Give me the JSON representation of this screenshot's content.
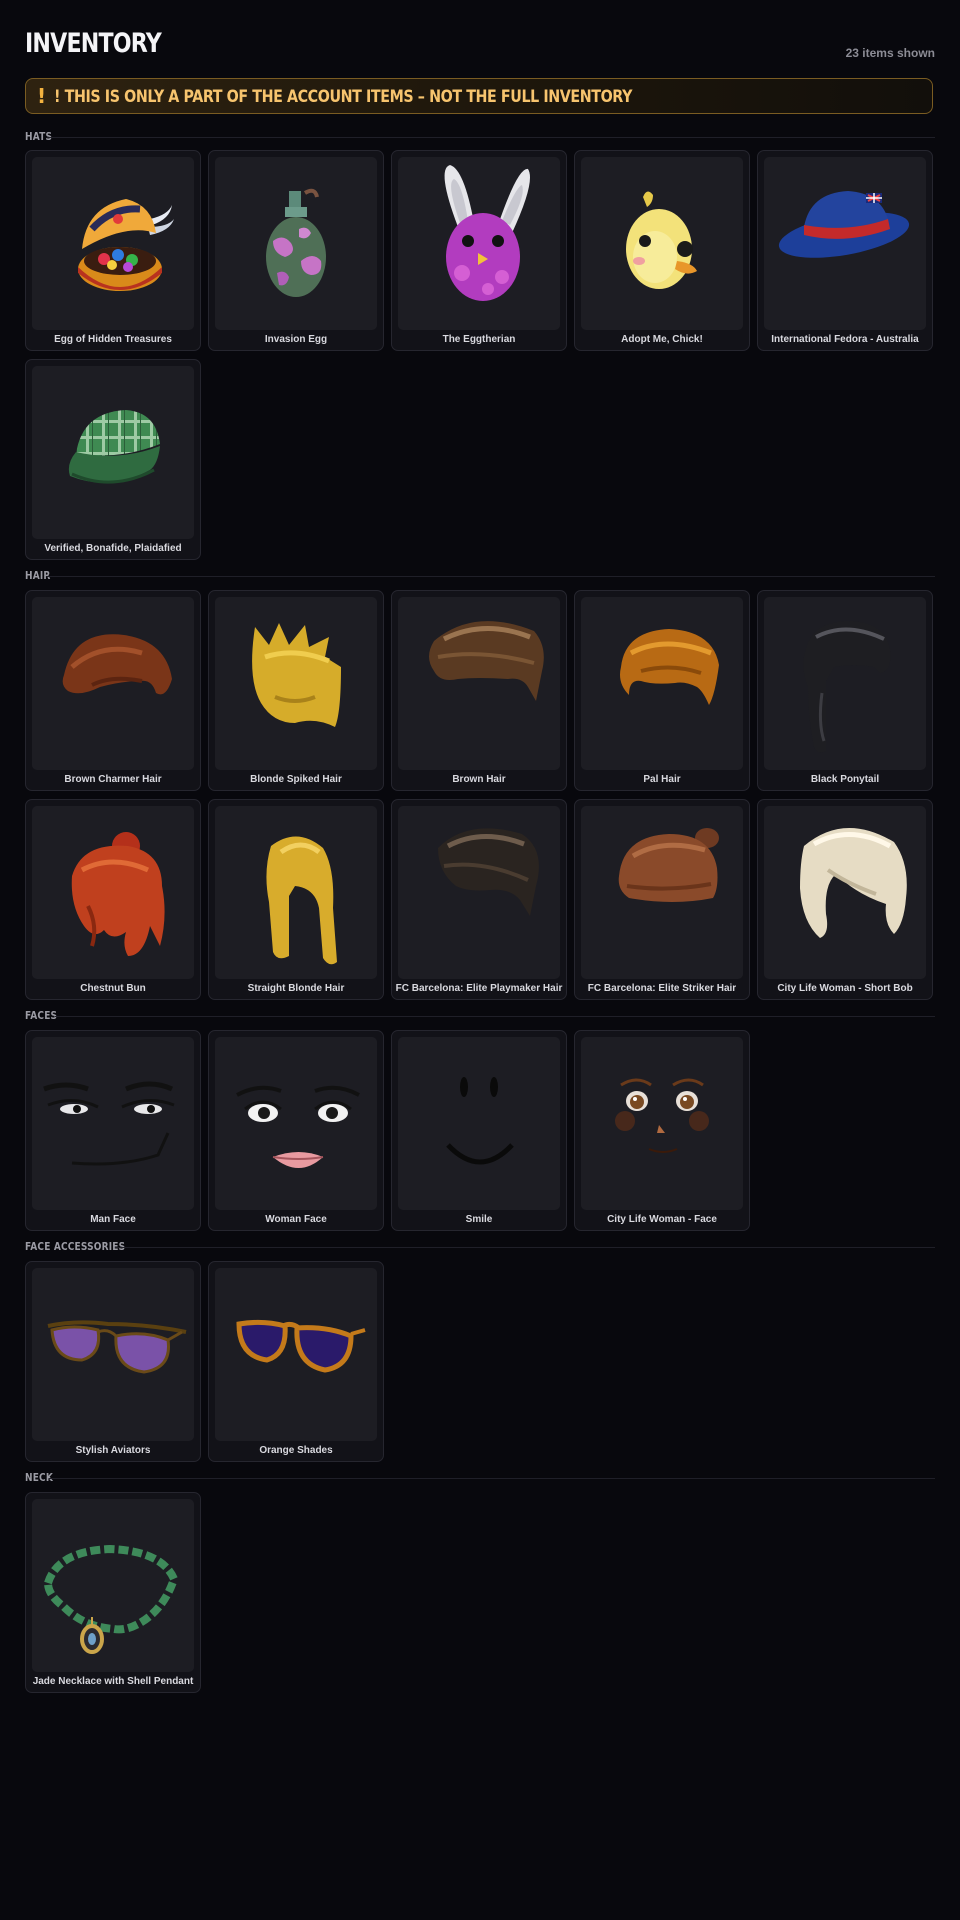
{
  "header": {
    "title": "INVENTORY",
    "count": "23 items shown"
  },
  "warning": {
    "icon": "exclamation-icon",
    "text": "! THIS IS ONLY A PART OF THE ACCOUNT ITEMS – NOT THE FULL INVENTORY"
  },
  "colors": {
    "background": "#08080d",
    "card": "#121218",
    "warning_accent": "#f7c46e"
  },
  "sections": {
    "hats": {
      "label": "HATS",
      "items": [
        {
          "name": "Egg of Hidden Treasures"
        },
        {
          "name": "Invasion Egg"
        },
        {
          "name": "The Eggtherian"
        },
        {
          "name": "Adopt Me, Chick!"
        },
        {
          "name": "International Fedora - Australia"
        },
        {
          "name": "Verified, Bonafide, Plaidafied"
        }
      ]
    },
    "hair": {
      "label": "HAIR",
      "items": [
        {
          "name": "Brown Charmer Hair"
        },
        {
          "name": "Blonde Spiked Hair"
        },
        {
          "name": "Brown Hair"
        },
        {
          "name": "Pal Hair"
        },
        {
          "name": "Black Ponytail"
        },
        {
          "name": "Chestnut Bun"
        },
        {
          "name": "Straight Blonde Hair"
        },
        {
          "name": "FC Barcelona: Elite Playmaker Hair"
        },
        {
          "name": "FC Barcelona: Elite Striker Hair"
        },
        {
          "name": "City Life Woman - Short Bob"
        }
      ]
    },
    "faces": {
      "label": "FACES",
      "items": [
        {
          "name": "Man Face"
        },
        {
          "name": "Woman Face"
        },
        {
          "name": "Smile"
        },
        {
          "name": "City Life Woman - Face"
        }
      ]
    },
    "face_accessories": {
      "label": "FACE ACCESSORIES",
      "items": [
        {
          "name": "Stylish Aviators"
        },
        {
          "name": "Orange Shades"
        }
      ]
    },
    "neck": {
      "label": "NECK",
      "items": [
        {
          "name": "Jade Necklace with Shell Pendant"
        }
      ]
    }
  }
}
